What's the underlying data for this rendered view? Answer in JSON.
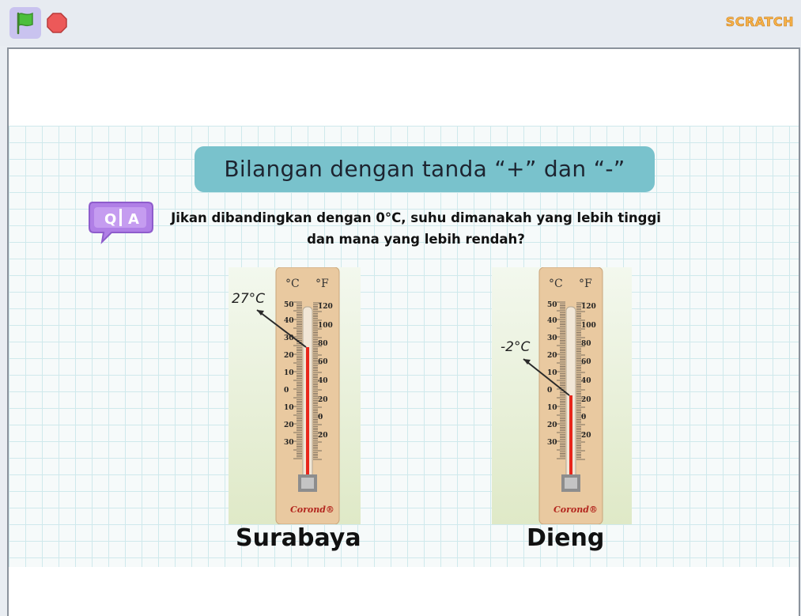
{
  "toolbar": {
    "green_flag_icon": "green-flag-icon",
    "stop_icon": "stop-icon",
    "logo_text": "SCRATCH"
  },
  "slide": {
    "title": "Bilangan dengan tanda “+” dan “-”",
    "qa_icon_text": "Q|A",
    "question_line1": "Jikan dibandingkan dengan 0°C, suhu dimanakah yang lebih tinggi",
    "question_line2": "dan mana yang lebih rendah?",
    "thermometers": [
      {
        "city": "Surabaya",
        "reading": "27°C",
        "brand": "Corond®",
        "unit_c": "°C",
        "unit_f": "°F",
        "celsius_ticks": [
          "50",
          "40",
          "30",
          "20",
          "10",
          "0",
          "10",
          "20",
          "30"
        ],
        "fahrenheit_ticks": [
          "120",
          "100",
          "80",
          "60",
          "40",
          "20",
          "0",
          "20"
        ]
      },
      {
        "city": "Dieng",
        "reading": "-2°C",
        "brand": "Corond®",
        "unit_c": "°C",
        "unit_f": "°F",
        "celsius_ticks": [
          "50",
          "40",
          "30",
          "20",
          "10",
          "0",
          "10",
          "20",
          "30"
        ],
        "fahrenheit_ticks": [
          "120",
          "100",
          "80",
          "60",
          "40",
          "20",
          "0",
          "20"
        ]
      }
    ]
  },
  "colors": {
    "title_bg": "#79c2cc",
    "qa_purple": "#b07fe6",
    "mercury": "#e8261b",
    "wood": "#e9c9a0"
  }
}
